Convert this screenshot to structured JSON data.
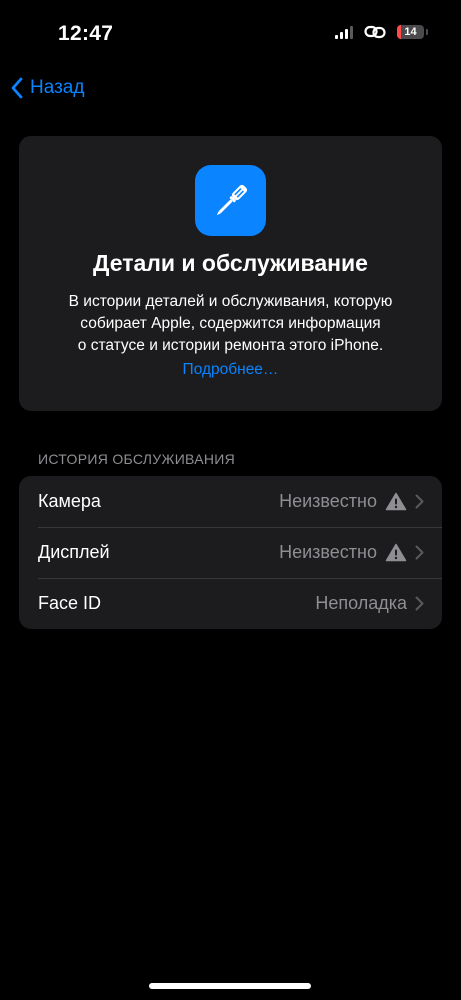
{
  "status_bar": {
    "time": "12:47",
    "battery_level": "14"
  },
  "nav": {
    "back_label": "Назад"
  },
  "info_card": {
    "icon": "screwdriver-icon",
    "title": "Детали и обслуживание",
    "description_lines": [
      "В истории деталей и обслуживания, которую",
      "собирает Apple, содержится информация",
      "о статусе и истории ремонта этого iPhone."
    ],
    "link": "Подробнее…"
  },
  "service_history": {
    "header": "ИСТОРИЯ ОБСЛУЖИВАНИЯ",
    "rows": [
      {
        "label": "Камера",
        "value": "Неизвестно",
        "warning": true
      },
      {
        "label": "Дисплей",
        "value": "Неизвестно",
        "warning": true
      },
      {
        "label": "Face ID",
        "value": "Неполадка",
        "warning": false
      }
    ]
  },
  "colors": {
    "accent": "#0a84ff",
    "background": "#000000",
    "card": "#1c1c1e",
    "secondary_text": "#8e8e93",
    "battery_low": "#ff4a4a"
  }
}
